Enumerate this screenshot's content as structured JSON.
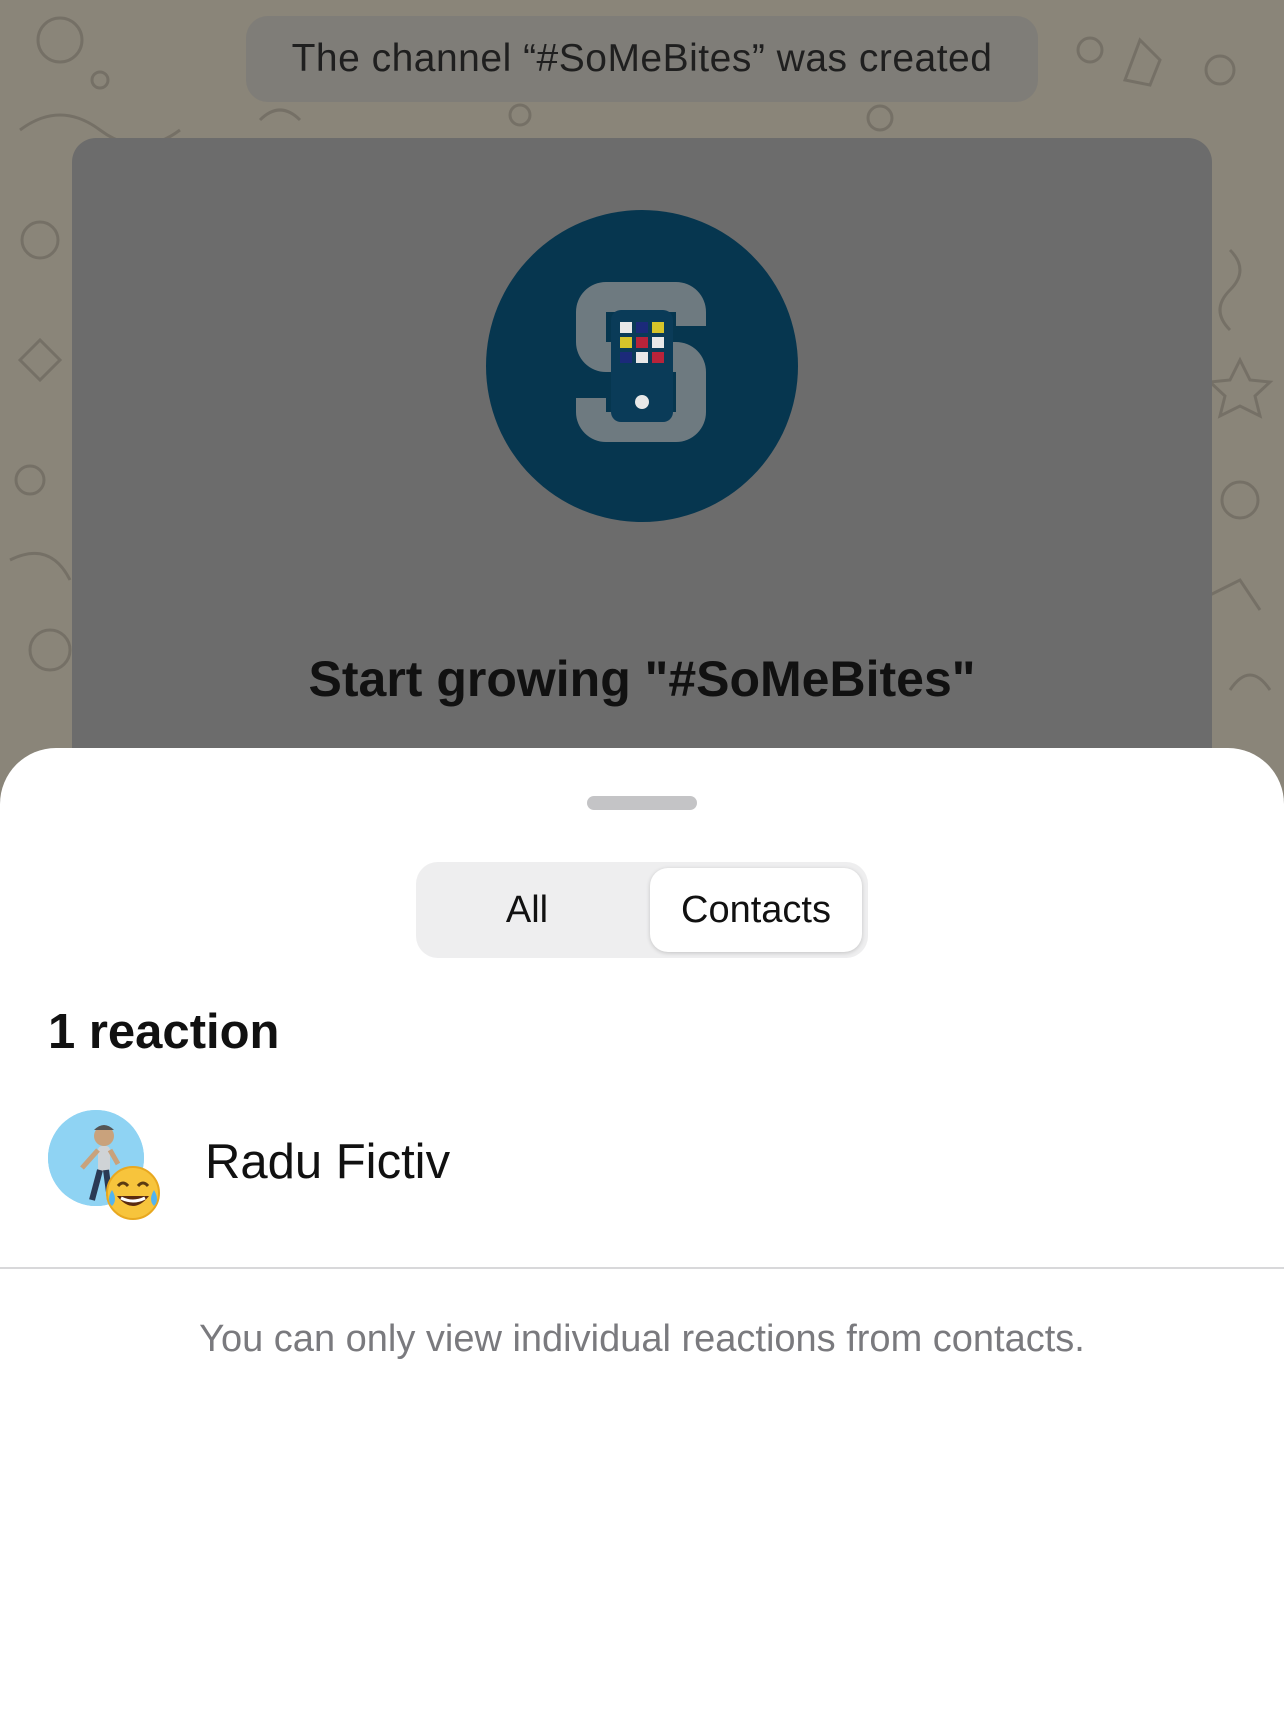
{
  "chat": {
    "system_message": "The channel “#SoMeBites” was created",
    "card_title": "Start growing \"#SoMeBites\""
  },
  "sheet": {
    "tabs": [
      {
        "label": "All",
        "selected": false
      },
      {
        "label": "Contacts",
        "selected": true
      }
    ],
    "reaction_count": "1 reaction",
    "reactions": [
      {
        "name": "Radu Fictiv",
        "emoji": "face-with-tears-of-joy"
      }
    ],
    "footnote": "You can only view individual reactions from contacts."
  },
  "colors": {
    "channel_avatar_bg": "#06364f",
    "sheet_bg": "#ffffff",
    "footnote": "#7a7a7e"
  }
}
